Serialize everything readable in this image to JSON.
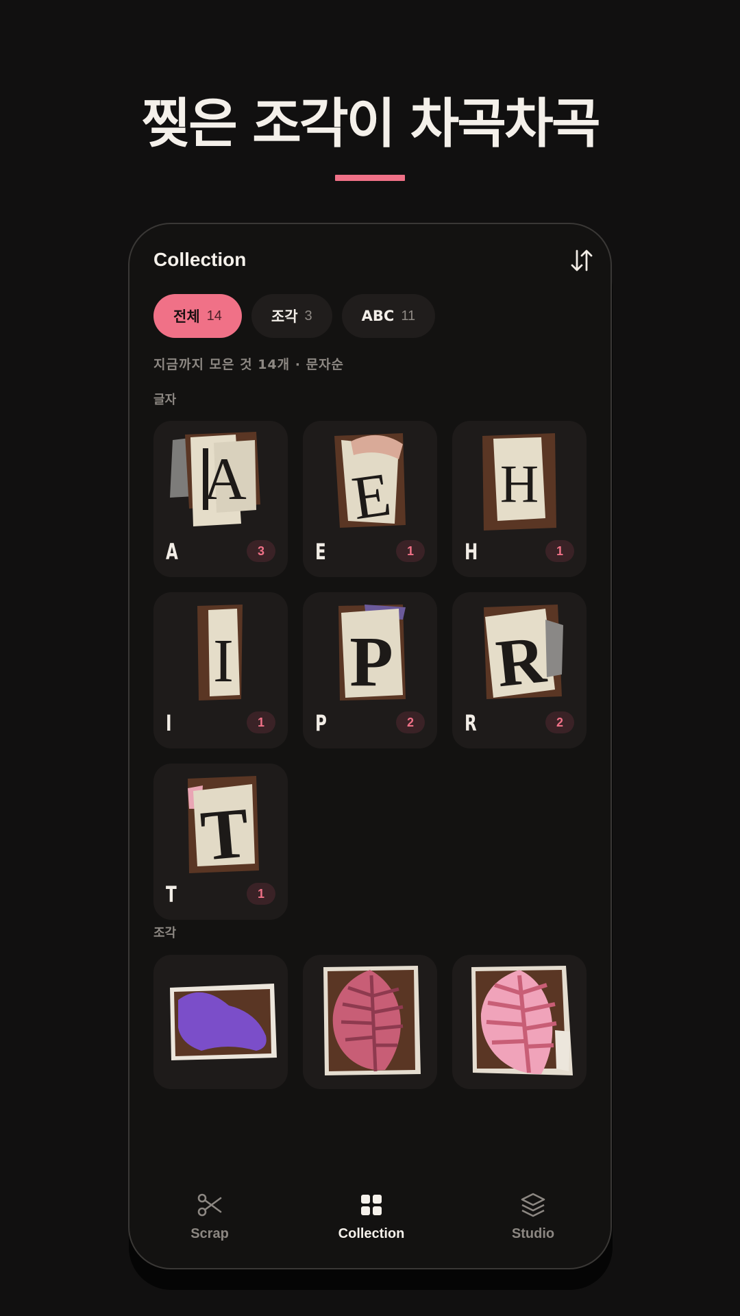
{
  "headline": "찢은 조각이 차곡차곡",
  "colors": {
    "accent": "#f07187",
    "background": "#111010",
    "card": "#1e1b1a"
  },
  "app": {
    "title": "Collection",
    "sort_icon": "sort-arrows-icon",
    "filters": [
      {
        "label": "전체",
        "count": "14",
        "active": true
      },
      {
        "label": "조각",
        "count": "3",
        "active": false
      },
      {
        "label": "ABC",
        "count": "11",
        "active": false
      }
    ],
    "summary": "지금까지 모은 것 14개 · 문자순",
    "letters_section": "글자",
    "letters": [
      {
        "glyph": "A",
        "count": "3"
      },
      {
        "glyph": "E",
        "count": "1"
      },
      {
        "glyph": "H",
        "count": "1"
      },
      {
        "glyph": "I",
        "count": "1"
      },
      {
        "glyph": "P",
        "count": "2"
      },
      {
        "glyph": "R",
        "count": "2"
      },
      {
        "glyph": "T",
        "count": "1"
      }
    ],
    "pieces_section": "조각",
    "pieces": [
      {
        "name": "purple-paper-scrap"
      },
      {
        "name": "dark-pink-leaf-scrap"
      },
      {
        "name": "light-pink-leaf-scrap"
      }
    ],
    "tabs": [
      {
        "label": "Scrap",
        "icon": "scissors-icon",
        "active": false
      },
      {
        "label": "Collection",
        "icon": "grid-icon",
        "active": true
      },
      {
        "label": "Studio",
        "icon": "layers-icon",
        "active": false
      }
    ]
  }
}
